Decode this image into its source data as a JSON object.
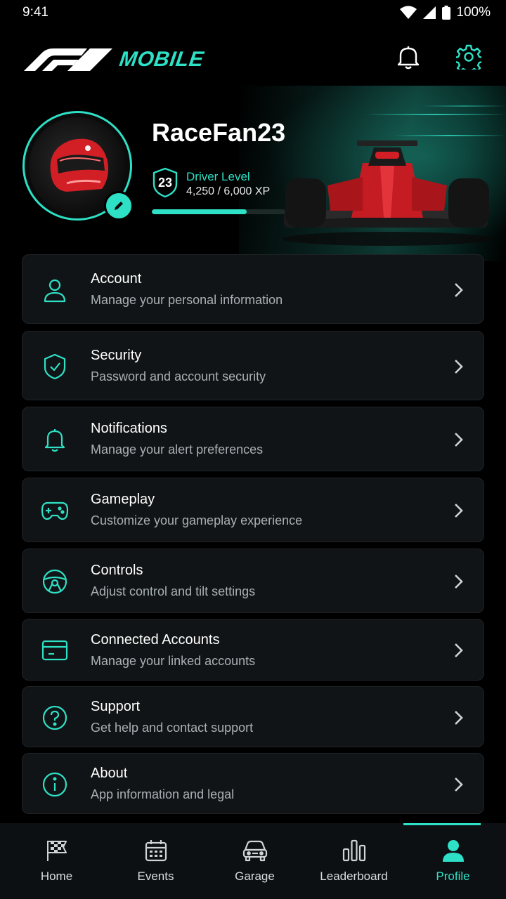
{
  "status_bar": {
    "time": "9:41",
    "battery": "100%"
  },
  "header": {
    "brand_suffix": "MOBILE",
    "icons": [
      "bell-icon",
      "gear-icon"
    ]
  },
  "profile": {
    "username": "RaceFan23",
    "level_number": "23",
    "level_label": "Driver Level",
    "xp_text": "4,250 / 6,000 XP",
    "xp_progress": 0.708
  },
  "menu": [
    {
      "title": "Account",
      "subtitle": "Manage your personal information",
      "icon": "user-icon"
    },
    {
      "title": "Security",
      "subtitle": "Password and account security",
      "icon": "shield-icon"
    },
    {
      "title": "Notifications",
      "subtitle": "Manage your alert preferences",
      "icon": "bell-icon"
    },
    {
      "title": "Gameplay",
      "subtitle": "Customize your gameplay experience",
      "icon": "gamepad-icon"
    },
    {
      "title": "Controls",
      "subtitle": "Adjust control and tilt settings",
      "icon": "steering-wheel-icon"
    },
    {
      "title": "Connected Accounts",
      "subtitle": "Manage your linked accounts",
      "icon": "wallet-icon"
    },
    {
      "title": "Support",
      "subtitle": "Get help and contact support",
      "icon": "help-icon"
    },
    {
      "title": "About",
      "subtitle": "App information and legal",
      "icon": "info-icon"
    }
  ],
  "nav": [
    {
      "label": "Home",
      "icon": "checkered-flag-icon"
    },
    {
      "label": "Events",
      "icon": "calendar-icon"
    },
    {
      "label": "Garage",
      "icon": "car-icon"
    },
    {
      "label": "Leaderboard",
      "icon": "bar-chart-icon"
    },
    {
      "label": "Profile",
      "icon": "person-icon",
      "active": true
    }
  ],
  "colors": {
    "accent": "#2ee0c5",
    "card": "#111416",
    "background": "#000000"
  }
}
